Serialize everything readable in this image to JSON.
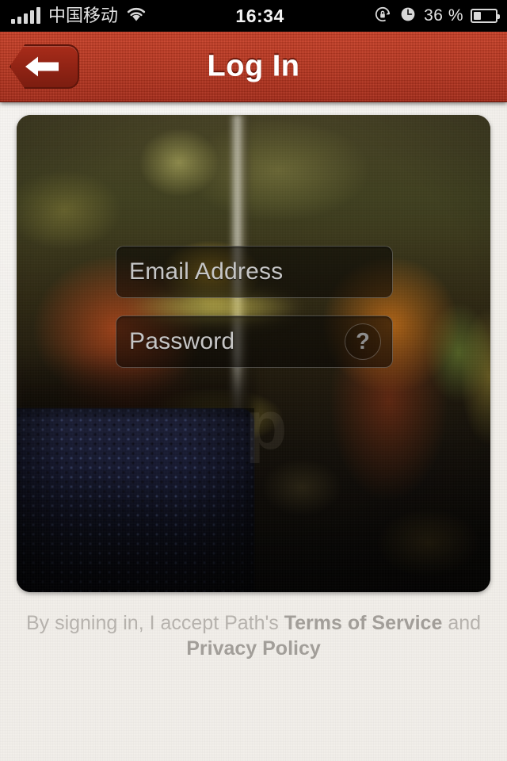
{
  "status_bar": {
    "carrier": "中国移动",
    "signal_icon": "signal-bars-icon",
    "signal_bars_filled": 5,
    "wifi_icon": "wifi-icon",
    "time": "16:34",
    "rotation_lock_icon": "rotation-lock-icon",
    "alarm_icon": "alarm-clock-icon",
    "battery_percent": "36 %",
    "battery_level": 36,
    "battery_icon": "battery-icon"
  },
  "nav_bar": {
    "title": "Log In",
    "back_icon": "back-arrow-icon",
    "back_label": "Back",
    "background_color": "#c23a22",
    "title_color": "#ffffff"
  },
  "photo": {
    "alt": "blurred bus interior photograph",
    "watermark": "p"
  },
  "form": {
    "email": {
      "value": "",
      "placeholder": "Email Address"
    },
    "password": {
      "value": "",
      "placeholder": "Password"
    },
    "help_label": "?"
  },
  "footer": {
    "prefix": "By signing in, I accept Path's ",
    "terms_link": "Terms of Service",
    "conjunction": " and ",
    "privacy_link": "Privacy Policy",
    "text_color": "#b6b2ad"
  }
}
